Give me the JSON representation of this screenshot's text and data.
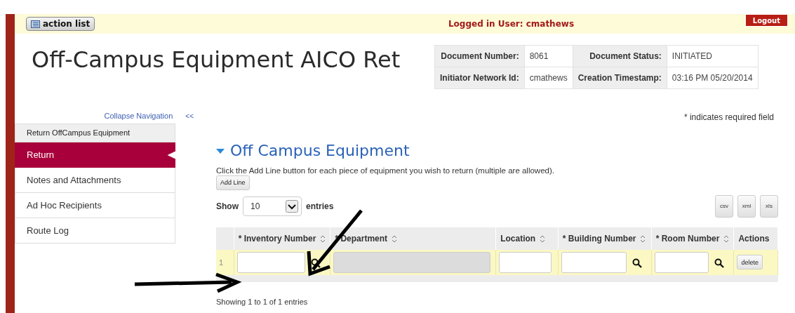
{
  "header": {
    "action_list_button": "action list",
    "logged_in": "Logged in User: cmathews",
    "logout_button": "Logout"
  },
  "page_title": "Off-Campus Equipment AICO Ret",
  "document_info": [
    {
      "label": "Document Number:",
      "value": "8061",
      "label_2": "Document Status:",
      "value_2": "INITIATED"
    },
    {
      "label": "Initiator Network Id:",
      "value": "cmathews",
      "label_2": "Creation Timestamp:",
      "value_2": "03:16 PM 05/20/2014"
    }
  ],
  "navigation": {
    "collapse_link": "Collapse Navigation",
    "collapse_icon": "<<",
    "header": "Return OffCampus Equipment",
    "items": [
      {
        "label": "Return",
        "selected": true
      },
      {
        "label": "Notes and Attachments",
        "selected": false
      },
      {
        "label": "Ad Hoc Recipients",
        "selected": false
      },
      {
        "label": "Route Log",
        "selected": false
      }
    ]
  },
  "required_note": "* indicates required field",
  "section": {
    "title": "Off Campus Equipment",
    "expanded": true,
    "instructions": "Click the Add Line button for each piece of equipment you wish to return (multiple are allowed).",
    "add_line_button": "Add Line",
    "show_label": "Show",
    "page_size": "10",
    "entries_label": "entries",
    "export_buttons": [
      "csv",
      "xml",
      "xls"
    ],
    "table": {
      "columns": [
        {
          "label": "* Inventory Number",
          "sortable": true
        },
        {
          "label": "* Department",
          "sortable": true
        },
        {
          "label": "Location",
          "sortable": true
        },
        {
          "label": "* Building Number",
          "sortable": true
        },
        {
          "label": "* Room Number",
          "sortable": true
        },
        {
          "label": "Actions",
          "sortable": false
        }
      ],
      "rows": [
        {
          "number": "1",
          "cells": [
            {
              "kind": "lookup"
            },
            {
              "kind": "disabled"
            },
            {
              "kind": "input"
            },
            {
              "kind": "lookup"
            },
            {
              "kind": "lookup"
            },
            {
              "kind": "button",
              "label": "delete"
            }
          ]
        }
      ]
    },
    "footer_info": "Showing 1 to 1 of 1 entries"
  }
}
